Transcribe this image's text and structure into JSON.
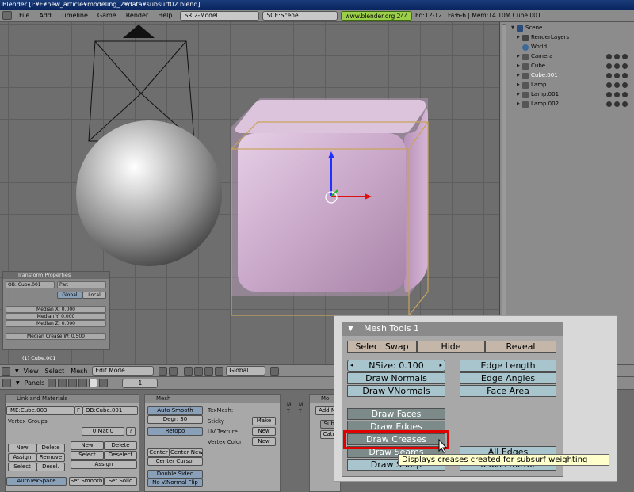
{
  "window": {
    "title": "Blender [i:¥F¥new_article¥modeling_2¥data¥subsurf02.blend]"
  },
  "top_header": {
    "menus": [
      "File",
      "Add",
      "Timeline",
      "Game",
      "Render",
      "Help"
    ],
    "screen": "SR:2-Model",
    "scene": "SCE:Scene",
    "url": "www.blender.org 244",
    "stats": "Ed:12-12 | Fa:6-6 | Mem:14.10M Cube.001"
  },
  "viewport": {
    "transform_panel": {
      "title": "Transform Properties",
      "ob": "OB: Cube.001",
      "par": "Par:",
      "global": "Global",
      "local": "Local",
      "median_x": "Median X: 0.000",
      "median_y": "Median Y: 0.000",
      "median_z": "Median Z: 0.000",
      "median_crease": "Median Crease W: 0.500"
    },
    "object_label": "(1) Cube.001"
  },
  "outliner": {
    "items": [
      {
        "label": "Scene",
        "depth": 0
      },
      {
        "label": "RenderLayers",
        "depth": 1
      },
      {
        "label": "World",
        "depth": 1
      },
      {
        "label": "Camera",
        "depth": 1
      },
      {
        "label": "Cube",
        "depth": 1
      },
      {
        "label": "Cube.001",
        "depth": 1
      },
      {
        "label": "Lamp",
        "depth": 1
      },
      {
        "label": "Lamp.001",
        "depth": 1
      },
      {
        "label": "Lamp.002",
        "depth": 1
      }
    ]
  },
  "view_header": {
    "menus": [
      "View",
      "Select",
      "Mesh"
    ],
    "mode": "Edit Mode",
    "orientation": "Global"
  },
  "buttons_header": {
    "panels": "Panels",
    "frame": "1"
  },
  "link_materials": {
    "title": "Link and Materials",
    "me": "ME:Cube.003",
    "f": "F",
    "ob": "OB:Cube.001",
    "vertex_groups": "Vertex Groups",
    "mat": "0 Mat 0",
    "q": "?",
    "new": "New",
    "delete": "Delete",
    "assign": "Assign",
    "remove": "Remove",
    "select": "Select",
    "desel": "Desel.",
    "new2": "New",
    "delete2": "Delete",
    "select2": "Select",
    "deselect2": "Deselect",
    "assign2": "Assign",
    "autotexspace": "AutoTexSpace",
    "set_smooth": "Set Smooth",
    "set_solid": "Set Solid"
  },
  "mesh_panel": {
    "title": "Mesh",
    "auto_smooth": "Auto Smooth",
    "degr": "Degr: 30",
    "retopo": "Retopo",
    "texmesh": "TexMesh:",
    "sticky": "Sticky",
    "uv_texture": "UV Texture",
    "vertex_color": "Vertex Color",
    "make": "Make",
    "new_uv": "New",
    "new_vc": "New",
    "center_new": "Center New",
    "center": "Center",
    "center_cursor": "Center Cursor",
    "double_sided": "Double Sided",
    "no_vnormal_flip": "No V.Normal Flip"
  },
  "modifiers": {
    "title": "Mo",
    "add": "Add M",
    "subsurf": "Subs",
    "catmull": "Catm"
  },
  "side_tabs": [
    "M",
    "T",
    "M",
    "T"
  ],
  "mesh_tools": {
    "title": "Mesh Tools 1",
    "select_swap": "Select Swap",
    "hide": "Hide",
    "reveal": "Reveal",
    "nsize": "NSize: 0.100",
    "draw_normals": "Draw Normals",
    "draw_vnormals": "Draw VNormals",
    "edge_length": "Edge Length",
    "edge_angles": "Edge Angles",
    "face_area": "Face Area",
    "draw_faces": "Draw Faces",
    "draw_edges": "Draw Edges",
    "draw_creases": "Draw Creases",
    "draw_seams": "Draw Seams",
    "draw_sharp": "Draw Sharp",
    "all_edges": "All Edges",
    "x_axis_mirror": "X-axis mirror",
    "tooltip": "Displays creases created for subsurf weighting"
  }
}
